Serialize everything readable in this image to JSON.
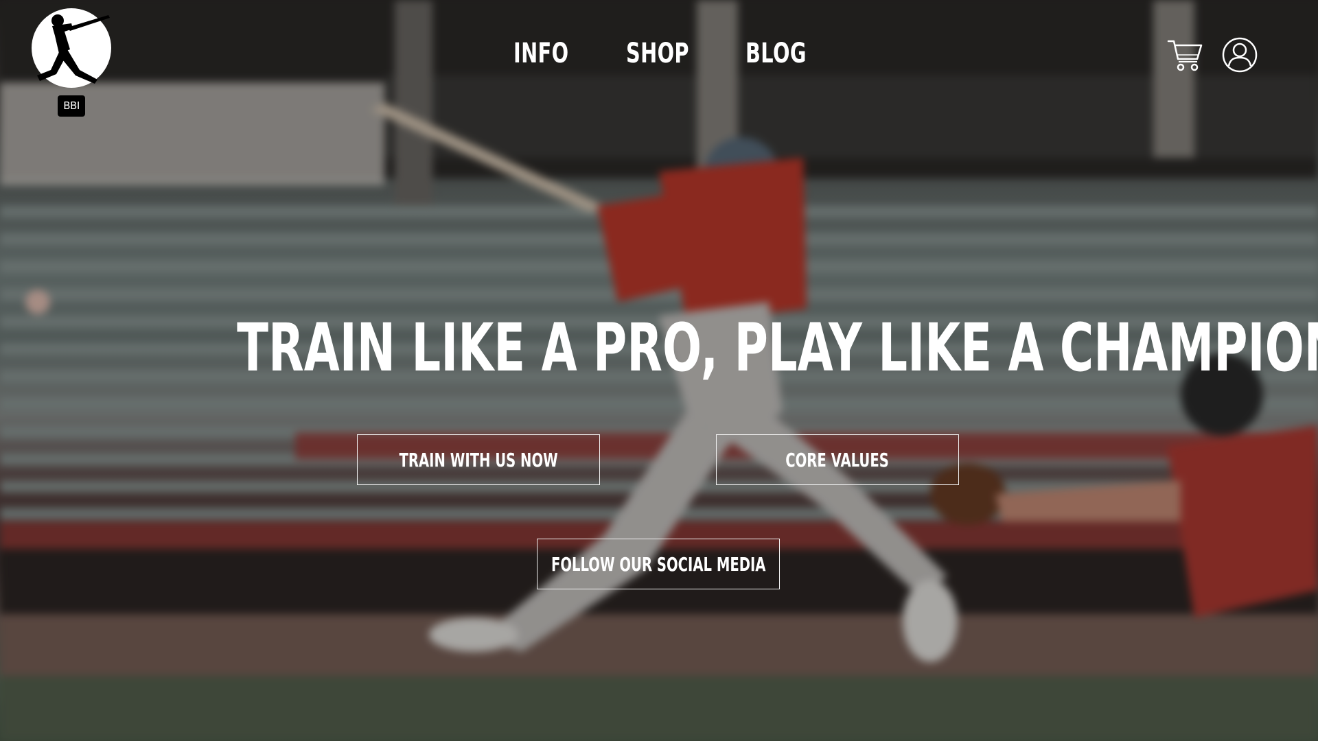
{
  "brand": {
    "logo_icon": "batter-silhouette-logo",
    "logo_text": "BBI"
  },
  "nav": {
    "items": [
      {
        "label": "INFO"
      },
      {
        "label": "SHOP"
      },
      {
        "label": "BLOG"
      }
    ]
  },
  "header_icons": {
    "cart": "cart-icon",
    "account": "user-icon"
  },
  "hero": {
    "title": "TRAIN LIKE A PRO, PLAY LIKE A CHAMPION",
    "buttons": {
      "train": "TRAIN WITH US NOW",
      "core": "CORE VALUES",
      "social": "FOLLOW OUR SOCIAL MEDIA"
    }
  },
  "colors": {
    "text": "#ffffff",
    "button_border": "#f2f2f2",
    "jersey_red": "#c0392b"
  }
}
